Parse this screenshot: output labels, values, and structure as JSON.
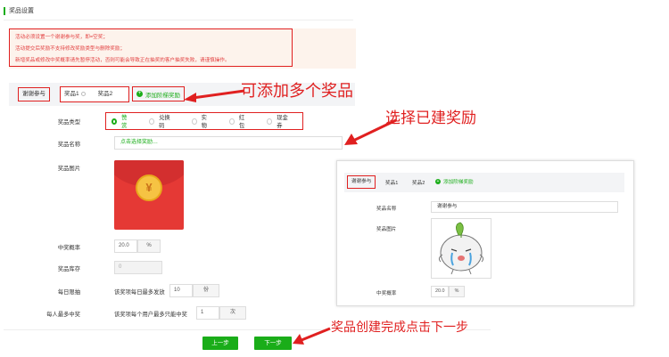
{
  "page": {
    "section_title": "奖品设置"
  },
  "notices": [
    "活动必须设置一个谢谢参与奖，即=空奖；",
    "活动提交后奖励不支持修改奖励类型与删除奖励；",
    "新增奖品或修改中奖概率请先暂停活动，否则可能会导致正在抽奖的客户抽奖失败，请谨慎操作。"
  ],
  "tabs": {
    "thanks": "谢谢参与",
    "prize1": "奖品1",
    "prize2": "奖品2",
    "add": "添加阶梯奖励"
  },
  "form": {
    "type_label": "奖品类型",
    "types": [
      "赞赏",
      "兑换码",
      "实物",
      "红包",
      "现金券"
    ],
    "selected_type": "赞赏",
    "name_label": "奖品名称",
    "name_placeholder": "点击选择奖励…",
    "image_label": "奖品图片",
    "rate_label": "中奖概率",
    "rate_value": "20.0",
    "rate_unit": "%",
    "stock_label": "奖品库存",
    "stock_value": "0",
    "daily_label": "每日限抽",
    "daily_text": "该奖项每日最多发放",
    "daily_value": "10",
    "daily_unit": "份",
    "per_user_label": "每人最多中奖",
    "per_user_text": "该奖项每个用户最多只能中奖",
    "per_user_value": "1",
    "per_user_unit": "次"
  },
  "buttons": {
    "prev": "上一步",
    "next": "下一步"
  },
  "annotations": {
    "add_multiple": "可添加多个奖品",
    "choose_existing": "选择已建奖励",
    "finish_next": "奖品创建完成点击下一步"
  },
  "popup": {
    "tabs": {
      "thanks": "谢谢参与",
      "prize1": "奖品1",
      "prize2": "奖品2",
      "add": "添加阶梯奖励"
    },
    "name_label": "奖品名称",
    "name_value": "谢谢参与",
    "image_label": "奖品图片",
    "rate_label": "中奖概率",
    "rate_value": "20.0",
    "rate_unit": "%"
  },
  "colors": {
    "accent": "#1aad19",
    "annotation": "#e02020",
    "notice_text": "#e23f3f",
    "notice_bg": "#fdf3ec"
  },
  "icons": {
    "coin": "¥"
  }
}
